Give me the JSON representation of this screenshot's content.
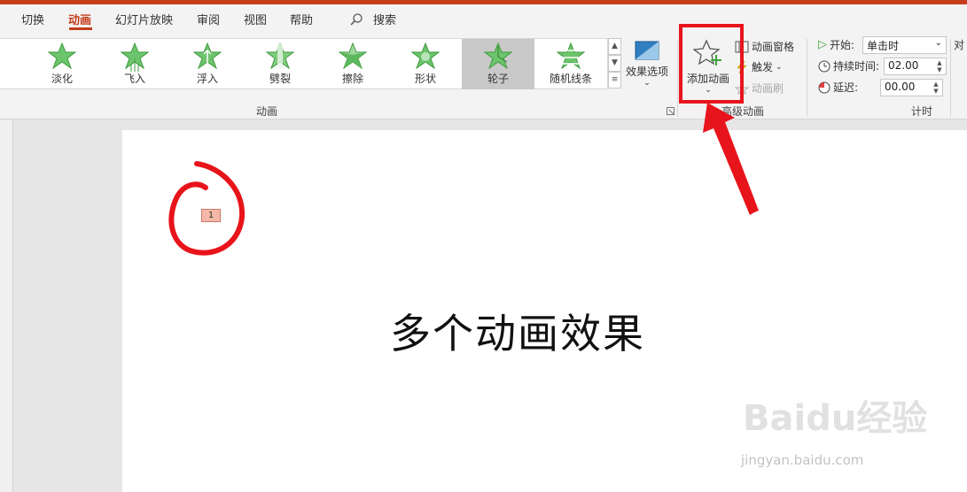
{
  "tabs": [
    {
      "label": "切换"
    },
    {
      "label": "动画"
    },
    {
      "label": "幻灯片放映"
    },
    {
      "label": "审阅"
    },
    {
      "label": "视图"
    },
    {
      "label": "帮助"
    }
  ],
  "search": {
    "label": "搜索"
  },
  "gallery": [
    {
      "label": "淡化"
    },
    {
      "label": "飞入"
    },
    {
      "label": "浮入"
    },
    {
      "label": "劈裂"
    },
    {
      "label": "擦除"
    },
    {
      "label": "形状"
    },
    {
      "label": "轮子"
    },
    {
      "label": "随机线条"
    }
  ],
  "ribbon": {
    "effect_options": "效果选项",
    "add_animation": "添加动画",
    "animation_pane": "动画窗格",
    "trigger": "触发",
    "animation_painter": "动画刷",
    "start_label": "开始:",
    "start_value": "单击时",
    "duration_label": "持续时间:",
    "duration_value": "02.00",
    "delay_label": "延迟:",
    "delay_value": "00.00",
    "reorder_partial": "对",
    "group_animation": "动画",
    "group_advanced": "高级动画",
    "group_timing": "计时"
  },
  "slide": {
    "title": "多个动画效果",
    "badge": "1"
  },
  "watermark": {
    "text": "Baidu经验",
    "url": "jingyan.baidu.com"
  },
  "colors": {
    "accent": "#c43e1c",
    "star_green": "#5cb85c",
    "annotation_red": "#e8141b"
  }
}
